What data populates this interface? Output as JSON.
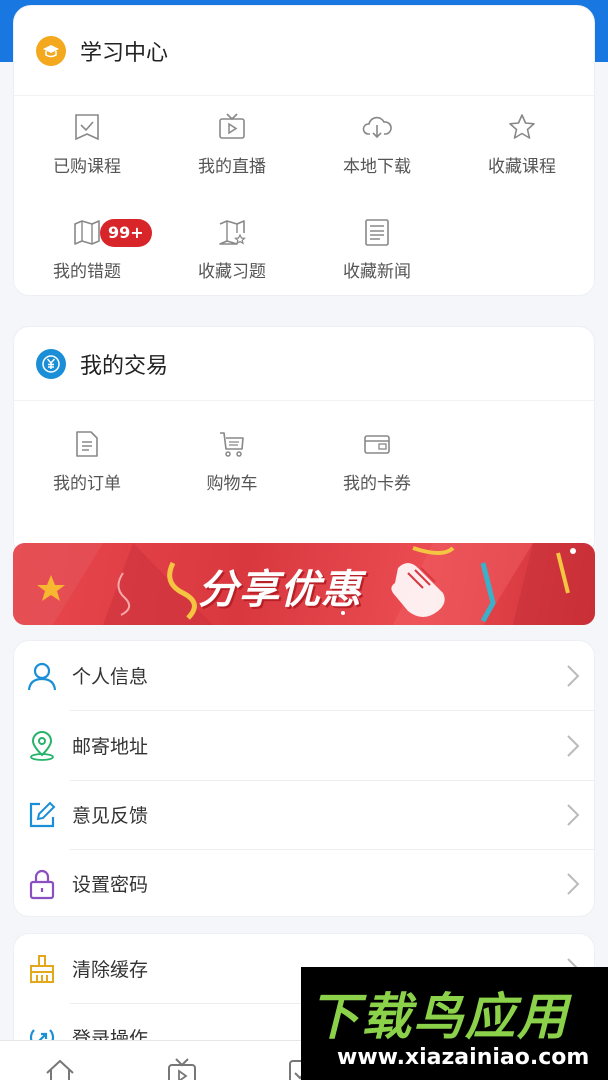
{
  "learning_center": {
    "title": "学习中心",
    "items": [
      {
        "label": "已购课程",
        "icon": "purchased-courses-icon"
      },
      {
        "label": "我的直播",
        "icon": "live-tv-icon"
      },
      {
        "label": "本地下载",
        "icon": "cloud-download-icon"
      },
      {
        "label": "收藏课程",
        "icon": "star-icon"
      },
      {
        "label": "我的错题",
        "icon": "map-icon",
        "badge": "99+"
      },
      {
        "label": "收藏习题",
        "icon": "map-star-icon"
      },
      {
        "label": "收藏新闻",
        "icon": "news-icon"
      }
    ]
  },
  "transactions": {
    "title": "我的交易",
    "items": [
      {
        "label": "我的订单",
        "icon": "order-document-icon"
      },
      {
        "label": "购物车",
        "icon": "shopping-cart-icon"
      },
      {
        "label": "我的卡券",
        "icon": "wallet-card-icon"
      }
    ]
  },
  "banner": {
    "text": "分享优惠"
  },
  "settings_list": [
    {
      "label": "个人信息",
      "icon": "user-icon",
      "color": "#1a8fd8"
    },
    {
      "label": "邮寄地址",
      "icon": "location-pin-icon",
      "color": "#27b36a"
    },
    {
      "label": "意见反馈",
      "icon": "edit-icon",
      "color": "#1a8fd8"
    },
    {
      "label": "设置密码",
      "icon": "lock-icon",
      "color": "#8a4fc0"
    }
  ],
  "system_list": [
    {
      "label": "清除缓存",
      "icon": "broom-icon",
      "color": "#e4a81c"
    },
    {
      "label": "登录操作",
      "icon": "login-icon",
      "color": "#1a8fd8"
    }
  ],
  "watermark": {
    "title": "下载鸟应用",
    "url": "www.xiazainiao.com"
  },
  "colors": {
    "accent": "#1877e0",
    "badge": "#d8252a",
    "banner": "#e0403f"
  }
}
